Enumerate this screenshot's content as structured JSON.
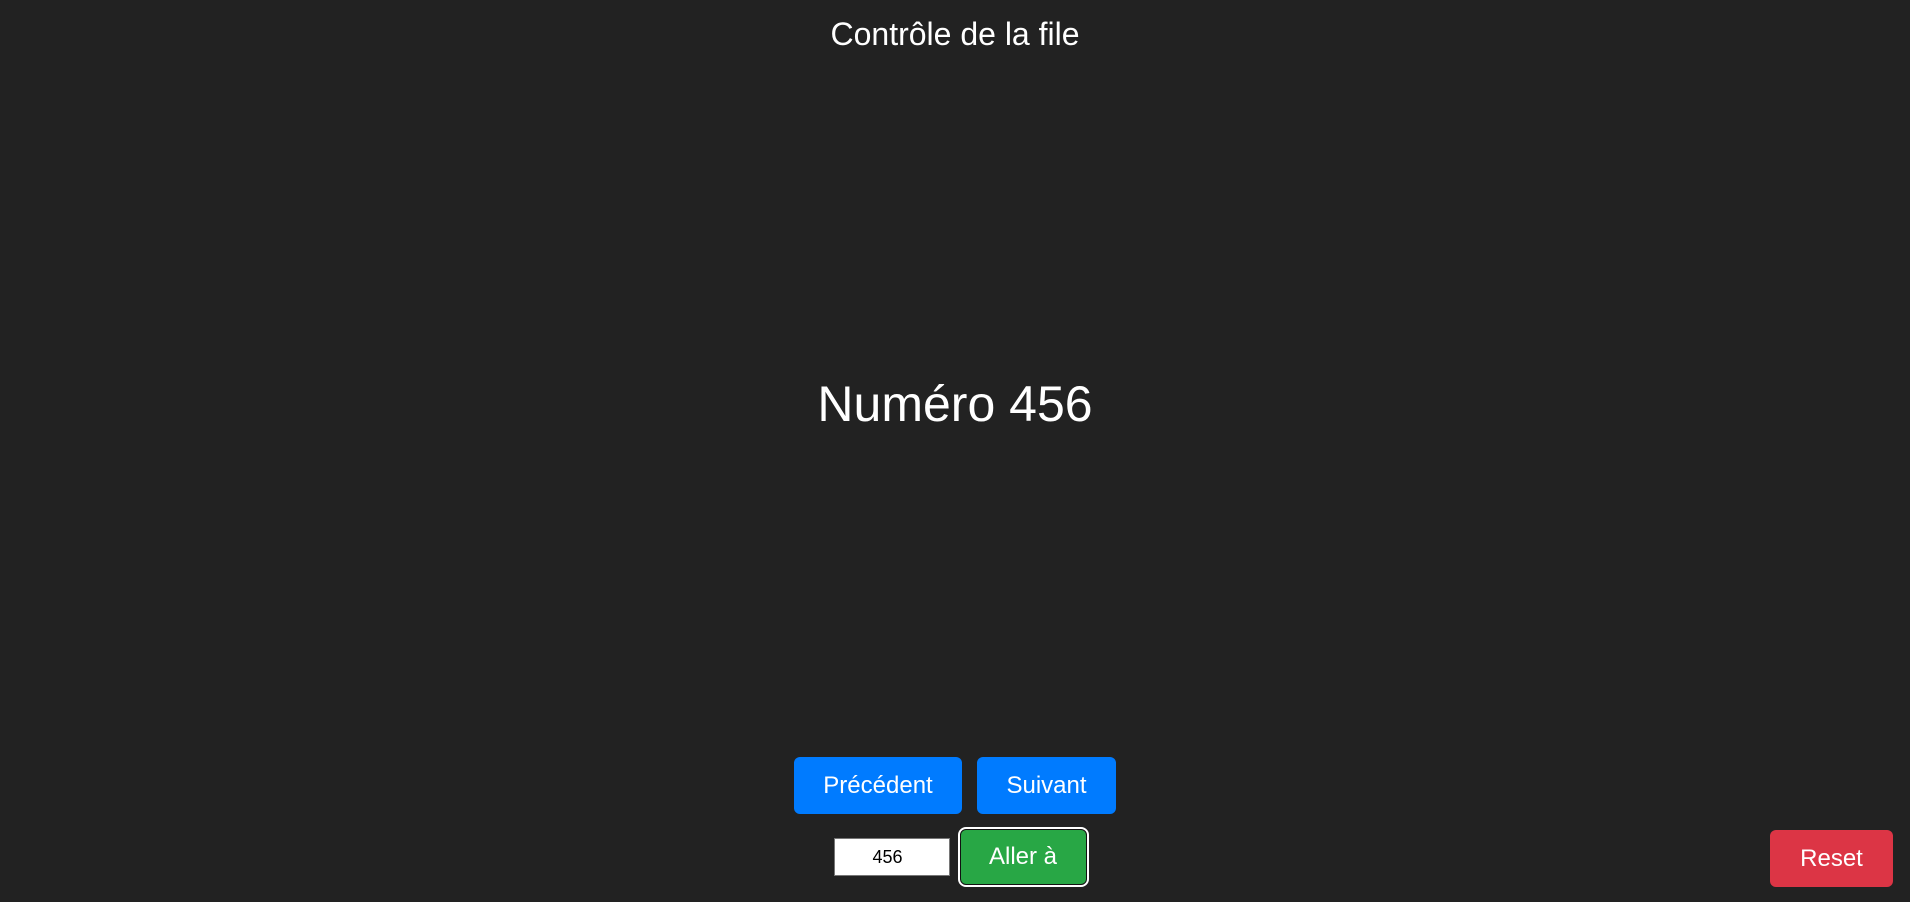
{
  "header": {
    "title": "Contrôle de la file"
  },
  "display": {
    "current_number": "Numéro 456"
  },
  "controls": {
    "previous_label": "Précédent",
    "next_label": "Suivant",
    "goto_input_value": "456",
    "goto_label": "Aller à",
    "reset_label": "Reset"
  },
  "colors": {
    "background": "#222222",
    "primary": "#007bff",
    "success": "#28a745",
    "danger": "#dc3545"
  }
}
